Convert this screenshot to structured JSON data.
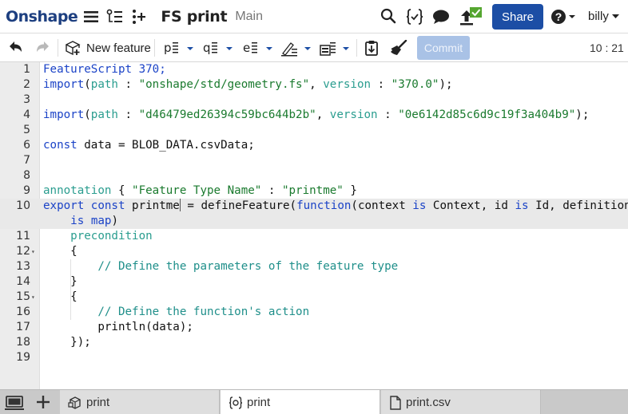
{
  "app": {
    "logo": "Onshape",
    "doc_title": "FS print",
    "branch": "Main",
    "share_label": "Share",
    "user_name": "billy",
    "accent": "#1c4ea5"
  },
  "toolbar": {
    "new_feature_label": "New feature",
    "commit_label": "Commit",
    "cursor_position": "10 : 21",
    "icons": [
      "undo-icon",
      "redo-icon",
      "new-feature-icon",
      "p-insert-icon",
      "q-insert-icon",
      "e-insert-icon",
      "sketch-insert-icon",
      "table-insert-icon",
      "clipboard-icon",
      "broom-icon"
    ]
  },
  "editor": {
    "lines": [
      {
        "n": "1",
        "parts": [
          {
            "t": "FeatureScript 370;",
            "c": "kw"
          }
        ]
      },
      {
        "n": "2",
        "parts": [
          {
            "t": "import",
            "c": "kw"
          },
          {
            "t": "(",
            "c": ""
          },
          {
            "t": "path",
            "c": "attr"
          },
          {
            "t": " : ",
            "c": ""
          },
          {
            "t": "\"onshape/std/geometry.fs\"",
            "c": "str"
          },
          {
            "t": ", ",
            "c": ""
          },
          {
            "t": "version",
            "c": "attr"
          },
          {
            "t": " : ",
            "c": ""
          },
          {
            "t": "\"370.0\"",
            "c": "str"
          },
          {
            "t": ");",
            "c": ""
          }
        ]
      },
      {
        "n": "3",
        "parts": []
      },
      {
        "n": "4",
        "parts": [
          {
            "t": "import",
            "c": "kw"
          },
          {
            "t": "(",
            "c": ""
          },
          {
            "t": "path",
            "c": "attr"
          },
          {
            "t": " : ",
            "c": ""
          },
          {
            "t": "\"d46479ed26394c59bc644b2b\"",
            "c": "str"
          },
          {
            "t": ", ",
            "c": ""
          },
          {
            "t": "version",
            "c": "attr"
          },
          {
            "t": " : ",
            "c": ""
          },
          {
            "t": "\"0e6142d85c6d9c19f3a404b9\"",
            "c": "str"
          },
          {
            "t": ");",
            "c": ""
          }
        ]
      },
      {
        "n": "5",
        "parts": []
      },
      {
        "n": "6",
        "parts": [
          {
            "t": "const",
            "c": "kw"
          },
          {
            "t": " data = BLOB_DATA.csvData;",
            "c": ""
          }
        ]
      },
      {
        "n": "7",
        "parts": []
      },
      {
        "n": "8",
        "parts": []
      },
      {
        "n": "9",
        "parts": [
          {
            "t": "annotation",
            "c": "attr"
          },
          {
            "t": " { ",
            "c": ""
          },
          {
            "t": "\"Feature Type Name\"",
            "c": "str"
          },
          {
            "t": " : ",
            "c": ""
          },
          {
            "t": "\"printme\"",
            "c": "str"
          },
          {
            "t": " }",
            "c": ""
          }
        ]
      },
      {
        "n": "10",
        "parts": [
          {
            "t": "export",
            "c": "kw"
          },
          {
            "t": " ",
            "c": ""
          },
          {
            "t": "const",
            "c": "kw"
          },
          {
            "t": " printme",
            "c": ""
          },
          {
            "t": "",
            "c": "caret"
          },
          {
            "t": " = defineFeature(",
            "c": ""
          },
          {
            "t": "function",
            "c": "kw"
          },
          {
            "t": "(context ",
            "c": ""
          },
          {
            "t": "is",
            "c": "kw"
          },
          {
            "t": " Context, id ",
            "c": ""
          },
          {
            "t": "is",
            "c": "kw"
          },
          {
            "t": " Id, definition",
            "c": ""
          }
        ]
      },
      {
        "n": "",
        "parts": [
          {
            "t": "    ",
            "c": ""
          },
          {
            "t": "is",
            "c": "kw"
          },
          {
            "t": " ",
            "c": ""
          },
          {
            "t": "map",
            "c": "kw"
          },
          {
            "t": ")",
            "c": ""
          }
        ]
      },
      {
        "n": "11",
        "parts": [
          {
            "t": "    ",
            "c": ""
          },
          {
            "t": "precondition",
            "c": "attr"
          }
        ]
      },
      {
        "n": "12",
        "fold": true,
        "parts": [
          {
            "t": "    {",
            "c": ""
          }
        ]
      },
      {
        "n": "13",
        "parts": [
          {
            "t": "        ",
            "c": ""
          },
          {
            "t": "// Define the parameters of the feature type",
            "c": "cm"
          }
        ]
      },
      {
        "n": "14",
        "parts": [
          {
            "t": "    }",
            "c": ""
          }
        ]
      },
      {
        "n": "15",
        "fold": true,
        "parts": [
          {
            "t": "    {",
            "c": ""
          }
        ]
      },
      {
        "n": "16",
        "parts": [
          {
            "t": "        ",
            "c": ""
          },
          {
            "t": "// Define the function's action",
            "c": "cm"
          }
        ]
      },
      {
        "n": "17",
        "parts": [
          {
            "t": "        println(data);",
            "c": ""
          }
        ]
      },
      {
        "n": "18",
        "parts": [
          {
            "t": "    });",
            "c": ""
          }
        ]
      },
      {
        "n": "19",
        "parts": []
      }
    ]
  },
  "tabs": [
    {
      "label": "print",
      "icon": "part-studio-icon",
      "active": false
    },
    {
      "label": "print",
      "icon": "feature-studio-icon",
      "active": true
    },
    {
      "label": "print.csv",
      "icon": "file-icon",
      "active": false
    }
  ]
}
